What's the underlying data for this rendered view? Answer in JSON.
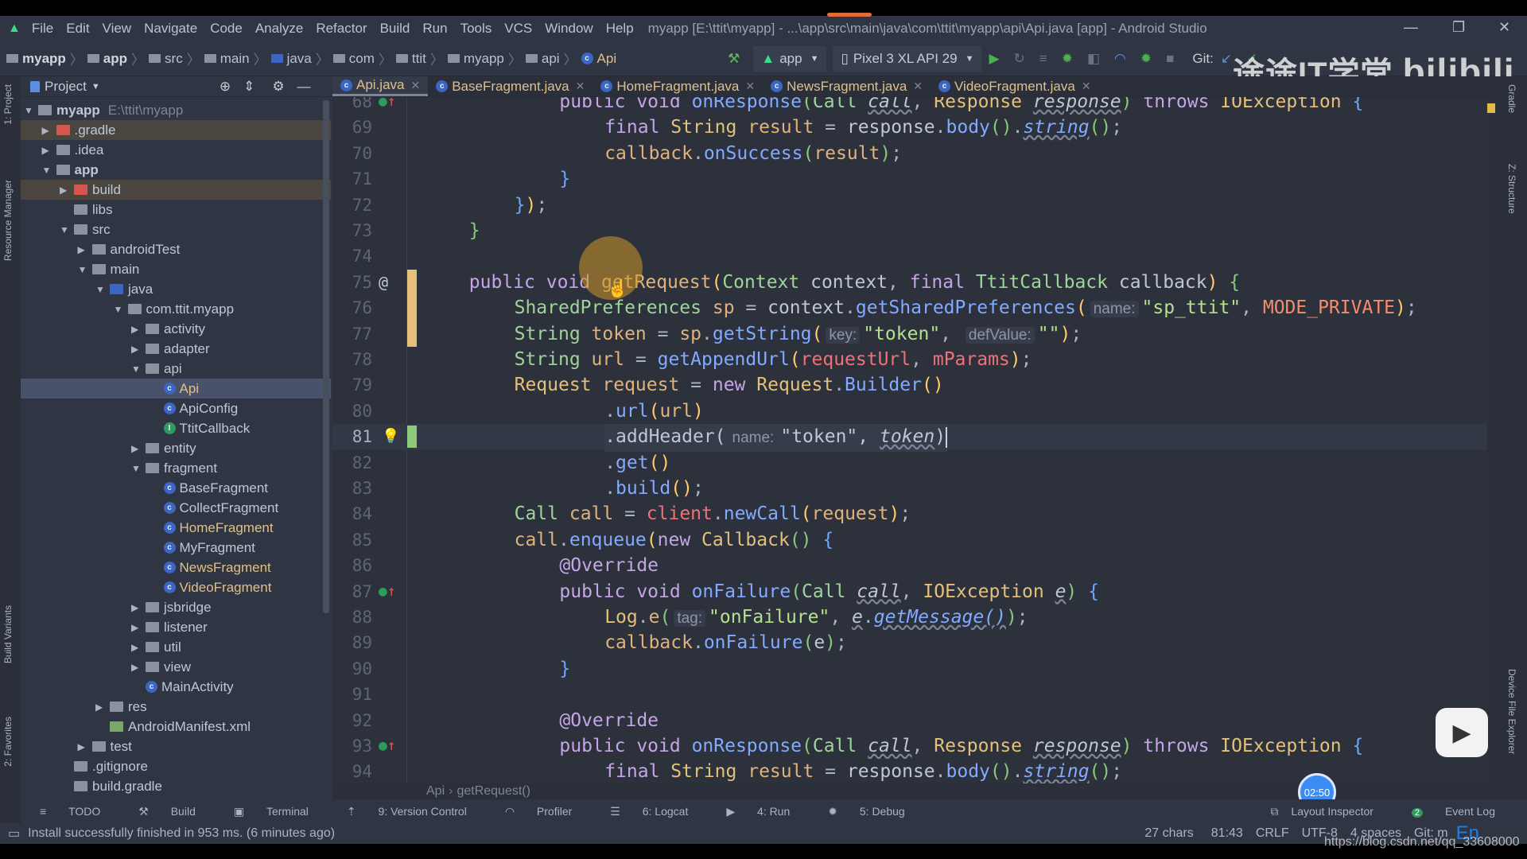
{
  "menu": [
    "File",
    "Edit",
    "View",
    "Navigate",
    "Code",
    "Analyze",
    "Refactor",
    "Build",
    "Run",
    "Tools",
    "VCS",
    "Window",
    "Help"
  ],
  "window_title": "myapp [E:\\ttit\\myapp] - ...\\app\\src\\main\\java\\com\\ttit\\myapp\\api\\Api.java [app] - Android Studio",
  "nav": {
    "crumbs": [
      "myapp",
      "app",
      "src",
      "main",
      "java",
      "com",
      "ttit",
      "myapp",
      "api",
      "Api"
    ],
    "run_config": "app",
    "device": "Pixel 3 XL API 29",
    "git_label": "Git:"
  },
  "project_panel": {
    "title": "Project",
    "tree": [
      {
        "label": "myapp",
        "depth": 0,
        "arrow": "open",
        "icon": "module",
        "bold": true,
        "extra": "E:\\ttit\\myapp"
      },
      {
        "label": ".gradle",
        "depth": 1,
        "arrow": "closed",
        "icon": "folder-red",
        "hl": true
      },
      {
        "label": ".idea",
        "depth": 1,
        "arrow": "closed",
        "icon": "folder"
      },
      {
        "label": "app",
        "depth": 1,
        "arrow": "open",
        "icon": "module",
        "bold": true
      },
      {
        "label": "build",
        "depth": 2,
        "arrow": "closed",
        "icon": "folder-red",
        "hl": true
      },
      {
        "label": "libs",
        "depth": 2,
        "arrow": "",
        "icon": "folder"
      },
      {
        "label": "src",
        "depth": 2,
        "arrow": "open",
        "icon": "folder"
      },
      {
        "label": "androidTest",
        "depth": 3,
        "arrow": "closed",
        "icon": "folder"
      },
      {
        "label": "main",
        "depth": 3,
        "arrow": "open",
        "icon": "folder"
      },
      {
        "label": "java",
        "depth": 4,
        "arrow": "open",
        "icon": "folder-blue"
      },
      {
        "label": "com.ttit.myapp",
        "depth": 5,
        "arrow": "open",
        "icon": "package"
      },
      {
        "label": "activity",
        "depth": 6,
        "arrow": "closed",
        "icon": "package"
      },
      {
        "label": "adapter",
        "depth": 6,
        "arrow": "closed",
        "icon": "package"
      },
      {
        "label": "api",
        "depth": 6,
        "arrow": "open",
        "icon": "package"
      },
      {
        "label": "Api",
        "depth": 7,
        "arrow": "",
        "icon": "class",
        "sel": true,
        "color": "#e0c089"
      },
      {
        "label": "ApiConfig",
        "depth": 7,
        "arrow": "",
        "icon": "class"
      },
      {
        "label": "TtitCallback",
        "depth": 7,
        "arrow": "",
        "icon": "interface"
      },
      {
        "label": "entity",
        "depth": 6,
        "arrow": "closed",
        "icon": "package"
      },
      {
        "label": "fragment",
        "depth": 6,
        "arrow": "open",
        "icon": "package"
      },
      {
        "label": "BaseFragment",
        "depth": 7,
        "arrow": "",
        "icon": "class"
      },
      {
        "label": "CollectFragment",
        "depth": 7,
        "arrow": "",
        "icon": "class"
      },
      {
        "label": "HomeFragment",
        "depth": 7,
        "arrow": "",
        "icon": "class",
        "color": "#e0c089"
      },
      {
        "label": "MyFragment",
        "depth": 7,
        "arrow": "",
        "icon": "class"
      },
      {
        "label": "NewsFragment",
        "depth": 7,
        "arrow": "",
        "icon": "class",
        "color": "#e0c089"
      },
      {
        "label": "VideoFragment",
        "depth": 7,
        "arrow": "",
        "icon": "class",
        "color": "#e0c089"
      },
      {
        "label": "jsbridge",
        "depth": 6,
        "arrow": "closed",
        "icon": "package"
      },
      {
        "label": "listener",
        "depth": 6,
        "arrow": "closed",
        "icon": "package"
      },
      {
        "label": "util",
        "depth": 6,
        "arrow": "closed",
        "icon": "package"
      },
      {
        "label": "view",
        "depth": 6,
        "arrow": "closed",
        "icon": "package"
      },
      {
        "label": "MainActivity",
        "depth": 6,
        "arrow": "",
        "icon": "class"
      },
      {
        "label": "res",
        "depth": 4,
        "arrow": "closed",
        "icon": "folder"
      },
      {
        "label": "AndroidManifest.xml",
        "depth": 4,
        "arrow": "",
        "icon": "manifest"
      },
      {
        "label": "test",
        "depth": 3,
        "arrow": "closed",
        "icon": "folder"
      },
      {
        "label": ".gitignore",
        "depth": 2,
        "arrow": "",
        "icon": "file"
      },
      {
        "label": "build.gradle",
        "depth": 2,
        "arrow": "",
        "icon": "gradle"
      }
    ]
  },
  "left_strip": [
    "1: Project",
    "Resource Manager",
    "Build Variants",
    "2: Favorites"
  ],
  "right_strip": [
    "Gradle",
    "Z: Structure",
    "Device File Explorer"
  ],
  "tabs": [
    {
      "label": "Api.java",
      "active": true
    },
    {
      "label": "BaseFragment.java"
    },
    {
      "label": "HomeFragment.java"
    },
    {
      "label": "NewsFragment.java"
    },
    {
      "label": "VideoFragment.java"
    }
  ],
  "editor": {
    "current_line": 81,
    "lines": [
      {
        "n": 68,
        "i": 12,
        "tk": [
          [
            "k",
            "public void "
          ],
          [
            "m",
            "onResponse"
          ],
          [
            "b2",
            "("
          ],
          [
            "t",
            "Call "
          ],
          [
            "pl i",
            "call"
          ],
          [
            "p",
            ", "
          ],
          [
            "t2",
            "Response "
          ],
          [
            "pl i",
            "response"
          ],
          [
            "b2",
            ")"
          ],
          [
            "k",
            " throws "
          ],
          [
            "t2",
            "IOException "
          ],
          [
            "b1",
            "{"
          ]
        ]
      },
      {
        "n": 69,
        "i": 16,
        "tk": [
          [
            "k",
            "final "
          ],
          [
            "t2",
            "String "
          ],
          [
            "v",
            "result"
          ],
          [
            "p",
            " = "
          ],
          [
            "pl",
            "response"
          ],
          [
            "p",
            "."
          ],
          [
            "m",
            "body"
          ],
          [
            "b2",
            "()"
          ],
          [
            "p",
            "."
          ],
          [
            "m i",
            "string"
          ],
          [
            "b2",
            "()"
          ],
          [
            "p",
            ";"
          ]
        ]
      },
      {
        "n": 70,
        "i": 16,
        "tk": [
          [
            "v",
            "callback"
          ],
          [
            "p",
            "."
          ],
          [
            "m",
            "onSuccess"
          ],
          [
            "b2",
            "("
          ],
          [
            "v",
            "result"
          ],
          [
            "b2",
            ")"
          ],
          [
            "p",
            ";"
          ]
        ]
      },
      {
        "n": 71,
        "i": 12,
        "tk": [
          [
            "b1",
            "}"
          ]
        ]
      },
      {
        "n": 72,
        "i": 8,
        "tk": [
          [
            "b1",
            "}"
          ],
          [
            "pa",
            ")"
          ],
          [
            "p",
            ";"
          ]
        ]
      },
      {
        "n": 73,
        "i": 4,
        "tk": [
          [
            "b2",
            "}"
          ]
        ]
      },
      {
        "n": 74,
        "i": 0,
        "tk": []
      },
      {
        "n": 75,
        "i": 4,
        "tk": [
          [
            "k",
            "public void "
          ],
          [
            "v",
            "getRequest"
          ],
          [
            "pa",
            "("
          ],
          [
            "t",
            "Context "
          ],
          [
            "pl",
            "context"
          ],
          [
            "p",
            ", "
          ],
          [
            "k",
            "final "
          ],
          [
            "t",
            "TtitCallback "
          ],
          [
            "pl",
            "callback"
          ],
          [
            "pa",
            ")"
          ],
          [
            "b2",
            " {"
          ]
        ]
      },
      {
        "n": 76,
        "i": 8,
        "tk": [
          [
            "t",
            "SharedPreferences "
          ],
          [
            "v",
            "sp"
          ],
          [
            "p",
            " = "
          ],
          [
            "pl",
            "context"
          ],
          [
            "p",
            "."
          ],
          [
            "m",
            "getSharedPreferences"
          ],
          [
            "pa",
            "("
          ],
          [
            "h",
            "name:"
          ],
          [
            "s",
            "\"sp_ttit\""
          ],
          [
            "p",
            ", "
          ],
          [
            "c",
            "MODE_PRIVATE"
          ],
          [
            "pa",
            ")"
          ],
          [
            "p",
            ";"
          ]
        ]
      },
      {
        "n": 77,
        "i": 8,
        "tk": [
          [
            "t",
            "String "
          ],
          [
            "v",
            "token"
          ],
          [
            "p",
            " = "
          ],
          [
            "v",
            "sp"
          ],
          [
            "p",
            "."
          ],
          [
            "m",
            "getString"
          ],
          [
            "pa",
            "("
          ],
          [
            "h",
            "key:"
          ],
          [
            "s",
            "\"token\""
          ],
          [
            "p",
            ", "
          ],
          [
            "h",
            "defValue:"
          ],
          [
            "s",
            "\"\""
          ],
          [
            "pa",
            ")"
          ],
          [
            "p",
            ";"
          ]
        ]
      },
      {
        "n": 78,
        "i": 8,
        "tk": [
          [
            "t",
            "String "
          ],
          [
            "v",
            "url"
          ],
          [
            "p",
            " = "
          ],
          [
            "m",
            "getAppendUrl"
          ],
          [
            "pa",
            "("
          ],
          [
            "f",
            "requestUrl"
          ],
          [
            "p",
            ", "
          ],
          [
            "f",
            "mParams"
          ],
          [
            "pa",
            ")"
          ],
          [
            "p",
            ";"
          ]
        ]
      },
      {
        "n": 79,
        "i": 8,
        "tk": [
          [
            "t2",
            "Request "
          ],
          [
            "v",
            "request"
          ],
          [
            "p",
            " = "
          ],
          [
            "k",
            "new "
          ],
          [
            "t2",
            "Request"
          ],
          [
            "p",
            "."
          ],
          [
            "m",
            "Builder"
          ],
          [
            "pa",
            "()"
          ]
        ]
      },
      {
        "n": 80,
        "i": 16,
        "tk": [
          [
            "p",
            "."
          ],
          [
            "m",
            "url"
          ],
          [
            "pa",
            "("
          ],
          [
            "v",
            "url"
          ],
          [
            "pa",
            ")"
          ]
        ]
      },
      {
        "n": 81,
        "i": 16,
        "tk": [
          [
            "pl",
            "."
          ],
          [
            "pl",
            "addHeader"
          ],
          [
            "pl",
            "("
          ],
          [
            "h",
            "name:"
          ],
          [
            "pl",
            "\"token\""
          ],
          [
            "pl",
            ", "
          ],
          [
            "pl i",
            "token"
          ],
          [
            "pl",
            ")"
          ]
        ]
      },
      {
        "n": 82,
        "i": 16,
        "tk": [
          [
            "p",
            "."
          ],
          [
            "m",
            "get"
          ],
          [
            "pa",
            "()"
          ]
        ]
      },
      {
        "n": 83,
        "i": 16,
        "tk": [
          [
            "p",
            "."
          ],
          [
            "m",
            "build"
          ],
          [
            "pa",
            "()"
          ],
          [
            "p",
            ";"
          ]
        ]
      },
      {
        "n": 84,
        "i": 8,
        "tk": [
          [
            "t",
            "Call "
          ],
          [
            "v",
            "call"
          ],
          [
            "p",
            " = "
          ],
          [
            "f",
            "client"
          ],
          [
            "p",
            "."
          ],
          [
            "m",
            "newCall"
          ],
          [
            "pa",
            "("
          ],
          [
            "v",
            "request"
          ],
          [
            "pa",
            ")"
          ],
          [
            "p",
            ";"
          ]
        ]
      },
      {
        "n": 85,
        "i": 8,
        "tk": [
          [
            "v",
            "call"
          ],
          [
            "p",
            "."
          ],
          [
            "m",
            "enqueue"
          ],
          [
            "pa",
            "("
          ],
          [
            "k",
            "new "
          ],
          [
            "t2",
            "Callback"
          ],
          [
            "b2",
            "()"
          ],
          [
            "b1",
            " {"
          ]
        ]
      },
      {
        "n": 86,
        "i": 12,
        "tk": [
          [
            "a",
            "@Override"
          ]
        ]
      },
      {
        "n": 87,
        "i": 12,
        "tk": [
          [
            "k",
            "public void "
          ],
          [
            "m",
            "onFailure"
          ],
          [
            "b2",
            "("
          ],
          [
            "t",
            "Call "
          ],
          [
            "pl i",
            "call"
          ],
          [
            "p",
            ", "
          ],
          [
            "t2",
            "IOException "
          ],
          [
            "pl i",
            "e"
          ],
          [
            "b2",
            ")"
          ],
          [
            "b1",
            " {"
          ]
        ]
      },
      {
        "n": 88,
        "i": 16,
        "tk": [
          [
            "t2",
            "Log"
          ],
          [
            "p",
            "."
          ],
          [
            "v",
            "e"
          ],
          [
            "b2",
            "("
          ],
          [
            "h",
            "tag:"
          ],
          [
            "s",
            "\"onFailure\""
          ],
          [
            "p",
            ", "
          ],
          [
            "pl i",
            "e"
          ],
          [
            "p",
            "."
          ],
          [
            "m i",
            "getMessage()"
          ],
          [
            "b2",
            ")"
          ],
          [
            "p",
            ";"
          ]
        ]
      },
      {
        "n": 89,
        "i": 16,
        "tk": [
          [
            "v",
            "callback"
          ],
          [
            "p",
            "."
          ],
          [
            "m",
            "onFailure"
          ],
          [
            "b2",
            "("
          ],
          [
            "pl",
            "e"
          ],
          [
            "b2",
            ")"
          ],
          [
            "p",
            ";"
          ]
        ]
      },
      {
        "n": 90,
        "i": 12,
        "tk": [
          [
            "b1",
            "}"
          ]
        ]
      },
      {
        "n": 91,
        "i": 0,
        "tk": []
      },
      {
        "n": 92,
        "i": 12,
        "tk": [
          [
            "a",
            "@Override"
          ]
        ]
      },
      {
        "n": 93,
        "i": 12,
        "tk": [
          [
            "k",
            "public void "
          ],
          [
            "m",
            "onResponse"
          ],
          [
            "b2",
            "("
          ],
          [
            "t",
            "Call "
          ],
          [
            "pl i",
            "call"
          ],
          [
            "p",
            ", "
          ],
          [
            "t2",
            "Response "
          ],
          [
            "pl i",
            "response"
          ],
          [
            "b2",
            ")"
          ],
          [
            "k",
            " throws "
          ],
          [
            "t2",
            "IOException "
          ],
          [
            "b1",
            "{"
          ]
        ]
      },
      {
        "n": 94,
        "i": 16,
        "tk": [
          [
            "k",
            "final "
          ],
          [
            "t2",
            "String "
          ],
          [
            "v",
            "result"
          ],
          [
            "p",
            " = "
          ],
          [
            "pl",
            "response"
          ],
          [
            "p",
            "."
          ],
          [
            "m",
            "body"
          ],
          [
            "b2",
            "()"
          ],
          [
            "p",
            "."
          ],
          [
            "m i",
            "string"
          ],
          [
            "b2",
            "()"
          ],
          [
            "p",
            ";"
          ]
        ]
      }
    ]
  },
  "editor_breadcrumb": [
    "Api",
    "getRequest()"
  ],
  "tool_windows": [
    "TODO",
    "Build",
    "Terminal",
    "9: Version Control",
    "Profiler",
    "6: Logcat",
    "4: Run",
    "5: Debug"
  ],
  "tool_windows_right": [
    "Layout Inspector",
    "Event Log"
  ],
  "event_log_count": "2",
  "status": {
    "message": "Install successfully finished in 953 ms. (6 minutes ago)",
    "chars": "27 chars",
    "position": "81:43",
    "line_sep": "CRLF",
    "encoding": "UTF-8",
    "indent": "4 spaces",
    "git": "Git: m",
    "ime": "En"
  },
  "overlay": {
    "timer": "02:50",
    "watermark_logo": "途途IT学堂 bilibili",
    "url_watermark": "https://blog.csdn.net/qq_33608000"
  },
  "colors": {
    "accent": "#3b66c4",
    "editor_bg": "#2c313c",
    "panel_bg": "#2f3542",
    "modified_marker": "#e5c07b",
    "added_marker": "#8fc97a"
  }
}
